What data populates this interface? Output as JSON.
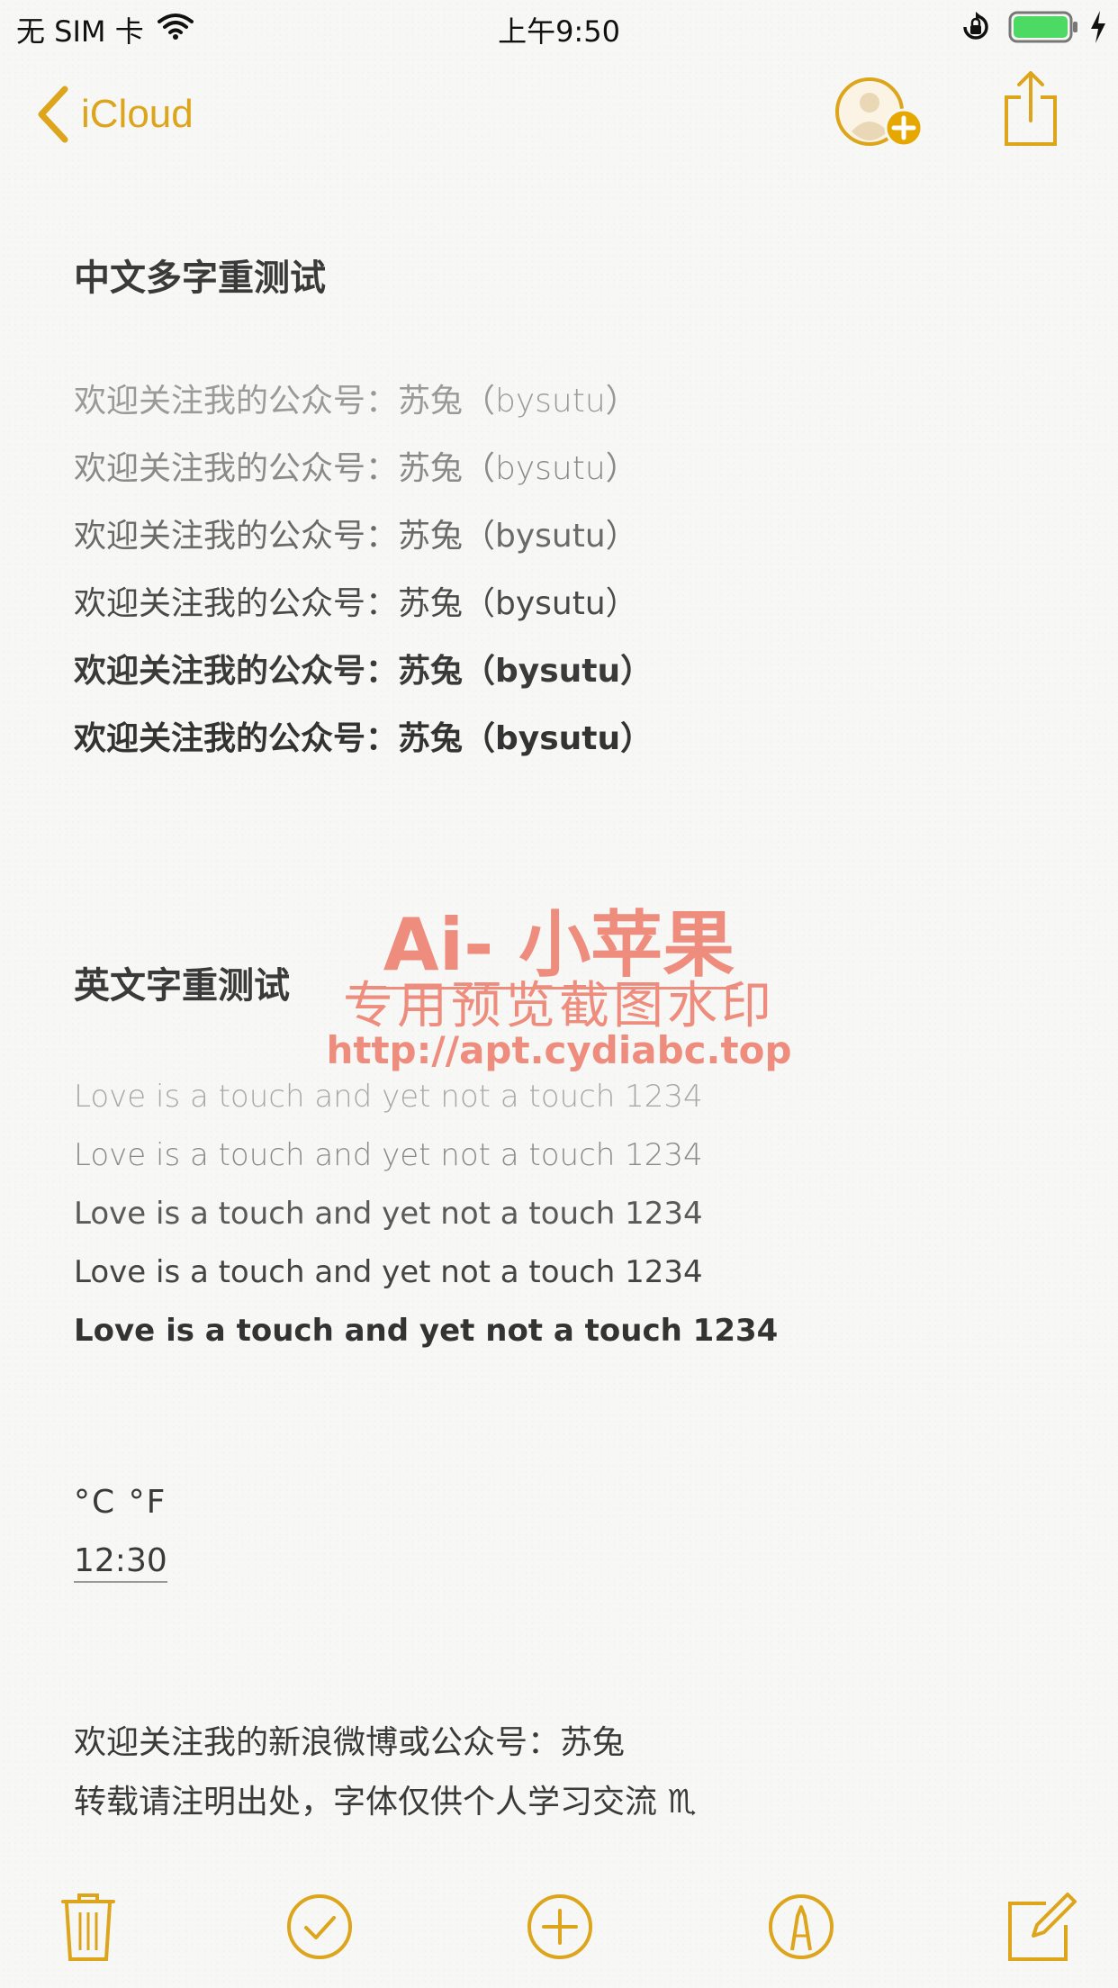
{
  "status_bar": {
    "carrier": "无 SIM 卡",
    "time": "上午9:50"
  },
  "nav": {
    "back_label": "iCloud"
  },
  "note": {
    "heading_zh": "中文多字重测试",
    "zh_lines": [
      "欢迎关注我的公众号：苏兔（bysutu）",
      "欢迎关注我的公众号：苏兔（bysutu）",
      "欢迎关注我的公众号：苏兔（bysutu）",
      "欢迎关注我的公众号：苏兔（bysutu）",
      "欢迎关注我的公众号：苏兔（bysutu）",
      "欢迎关注我的公众号：苏兔（bysutu）"
    ],
    "heading_en": "英文字重测试",
    "en_lines": [
      "Love is a touch and yet not a touch  1234",
      "Love is a touch and yet not a touch  1234",
      "Love is a touch and yet not a touch  1234",
      "Love is a touch and yet not a touch  1234",
      "Love is a touch and yet not a touch  1234"
    ],
    "temps": "°C  °F",
    "time_value": "12:30",
    "footer_line1": "欢迎关注我的新浪微博或公众号：苏兔",
    "footer_line2": "转载请注明出处，字体仅供个人学习交流 ♏"
  },
  "watermark": {
    "title": "Ai- 小苹果",
    "subtitle": "专用预览截图水印",
    "url": "http://apt.cydiabc.top"
  },
  "colors": {
    "accent": "#dca51c",
    "watermark": "#ee8d7e"
  }
}
